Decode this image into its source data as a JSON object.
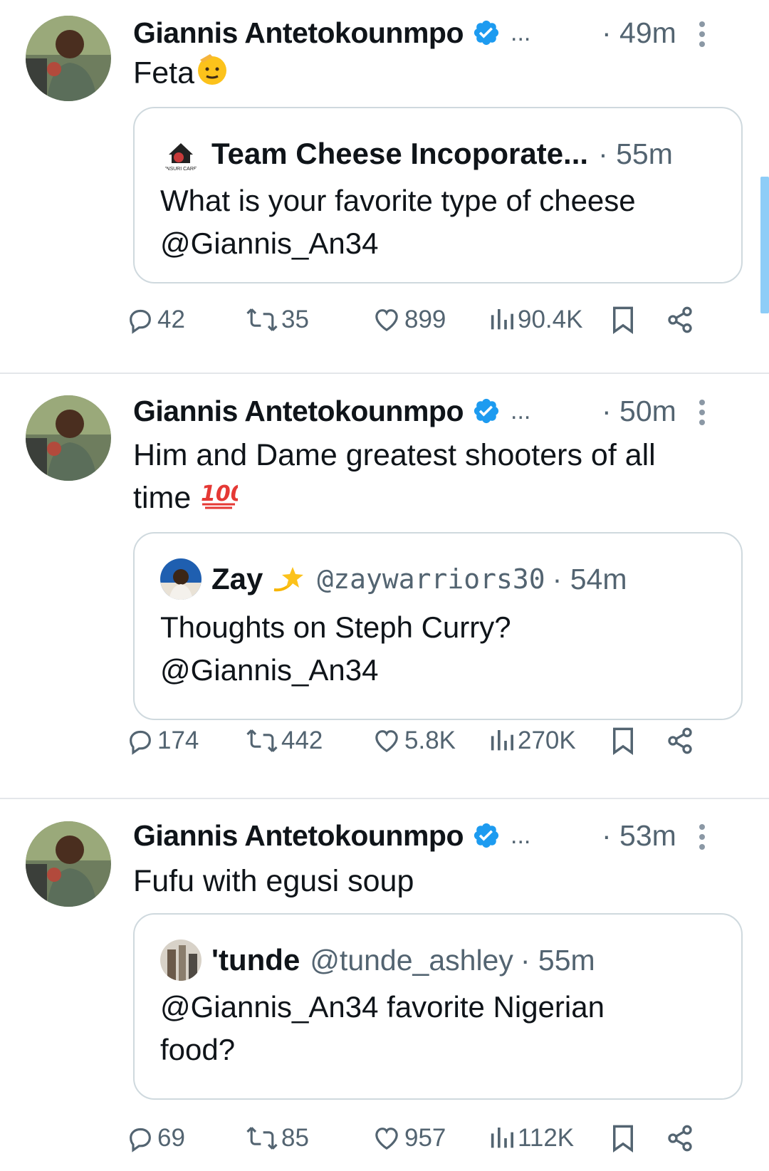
{
  "colors": {
    "verified": "#1d9bf0",
    "muted": "#536471",
    "text": "#0f1419",
    "border": "#cfd9de",
    "scroll": "#8ecdf7"
  },
  "tweets": [
    {
      "author": "Giannis Antetokounmpo",
      "ellipsis": "...",
      "time": "· 49m",
      "text": "Feta",
      "emoji": "saluting-face",
      "quote": {
        "name": "Team Cheese Incoporate...",
        "handle": "",
        "badge": "",
        "time": "· 55m",
        "text": "What is your favorite type of cheese @Giannis_An34"
      },
      "stats": {
        "replies": "42",
        "reposts": "35",
        "likes": "899",
        "views": "90.4K"
      }
    },
    {
      "author": "Giannis Antetokounmpo",
      "ellipsis": "...",
      "time": "· 50m",
      "text": "Him and Dame greatest shooters of all time",
      "emoji": "hundred-points",
      "quote": {
        "name": "Zay",
        "handle": "@zaywarriors30",
        "badge": "dizzy",
        "time": "· 54m",
        "text": "Thoughts on Steph Curry? @Giannis_An34"
      },
      "stats": {
        "replies": "174",
        "reposts": "442",
        "likes": "5.8K",
        "views": "270K"
      }
    },
    {
      "author": "Giannis Antetokounmpo",
      "ellipsis": "...",
      "time": "· 53m",
      "text": "Fufu with egusi soup",
      "emoji": "",
      "quote": {
        "name": "'tunde",
        "handle": "@tunde_ashley",
        "badge": "",
        "time": "· 55m",
        "text": "@Giannis_An34 favorite Nigerian food?"
      },
      "stats": {
        "replies": "69",
        "reposts": "85",
        "likes": "957",
        "views": "112K"
      }
    }
  ]
}
